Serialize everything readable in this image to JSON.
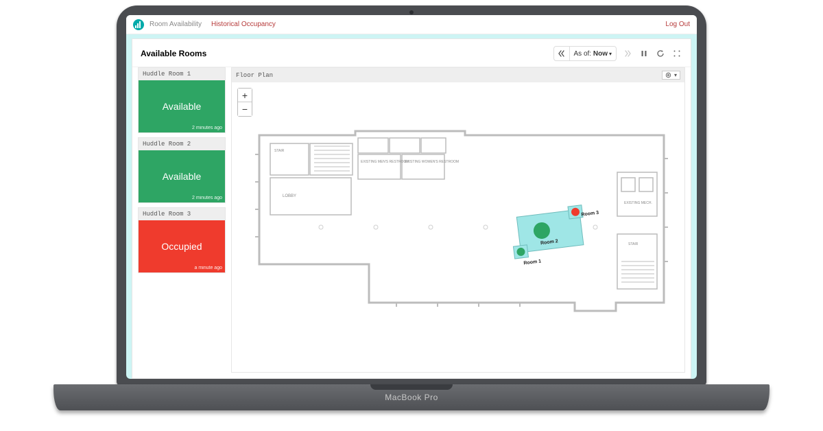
{
  "device_label": "MacBook Pro",
  "nav": {
    "tab_availability": "Room Availability",
    "tab_history": "Historical Occupancy",
    "logout": "Log Out"
  },
  "page": {
    "title": "Available Rooms",
    "asof_prefix": "As of:",
    "asof_value": "Now"
  },
  "sidebar": {
    "rooms": [
      {
        "name": "Huddle Room 1",
        "status": "Available",
        "status_key": "available",
        "updated": "2 minutes ago"
      },
      {
        "name": "Huddle Room 2",
        "status": "Available",
        "status_key": "available",
        "updated": "2 minutes ago"
      },
      {
        "name": "Huddle Room 3",
        "status": "Occupied",
        "status_key": "occupied",
        "updated": "a minute ago"
      }
    ]
  },
  "floorplan": {
    "title": "Floor Plan",
    "labels": {
      "lobby": "LOBBY",
      "stair_left": "STAIR",
      "stair_right": "STAIR",
      "mens": "EXISTING\nMEN'S\nRESTROOM",
      "womens": "EXISTING\nWOMEN'S\nRESTROOM",
      "mech": "EXISTING\nMECH."
    },
    "rooms": [
      {
        "id": 1,
        "label": "Room 1",
        "status": "available"
      },
      {
        "id": 2,
        "label": "Room 2",
        "status": "available"
      },
      {
        "id": 3,
        "label": "Room 3",
        "status": "occupied"
      }
    ]
  },
  "colors": {
    "available": "#2ea564",
    "occupied": "#ef3b2d",
    "highlight": "#9fe6e6"
  }
}
